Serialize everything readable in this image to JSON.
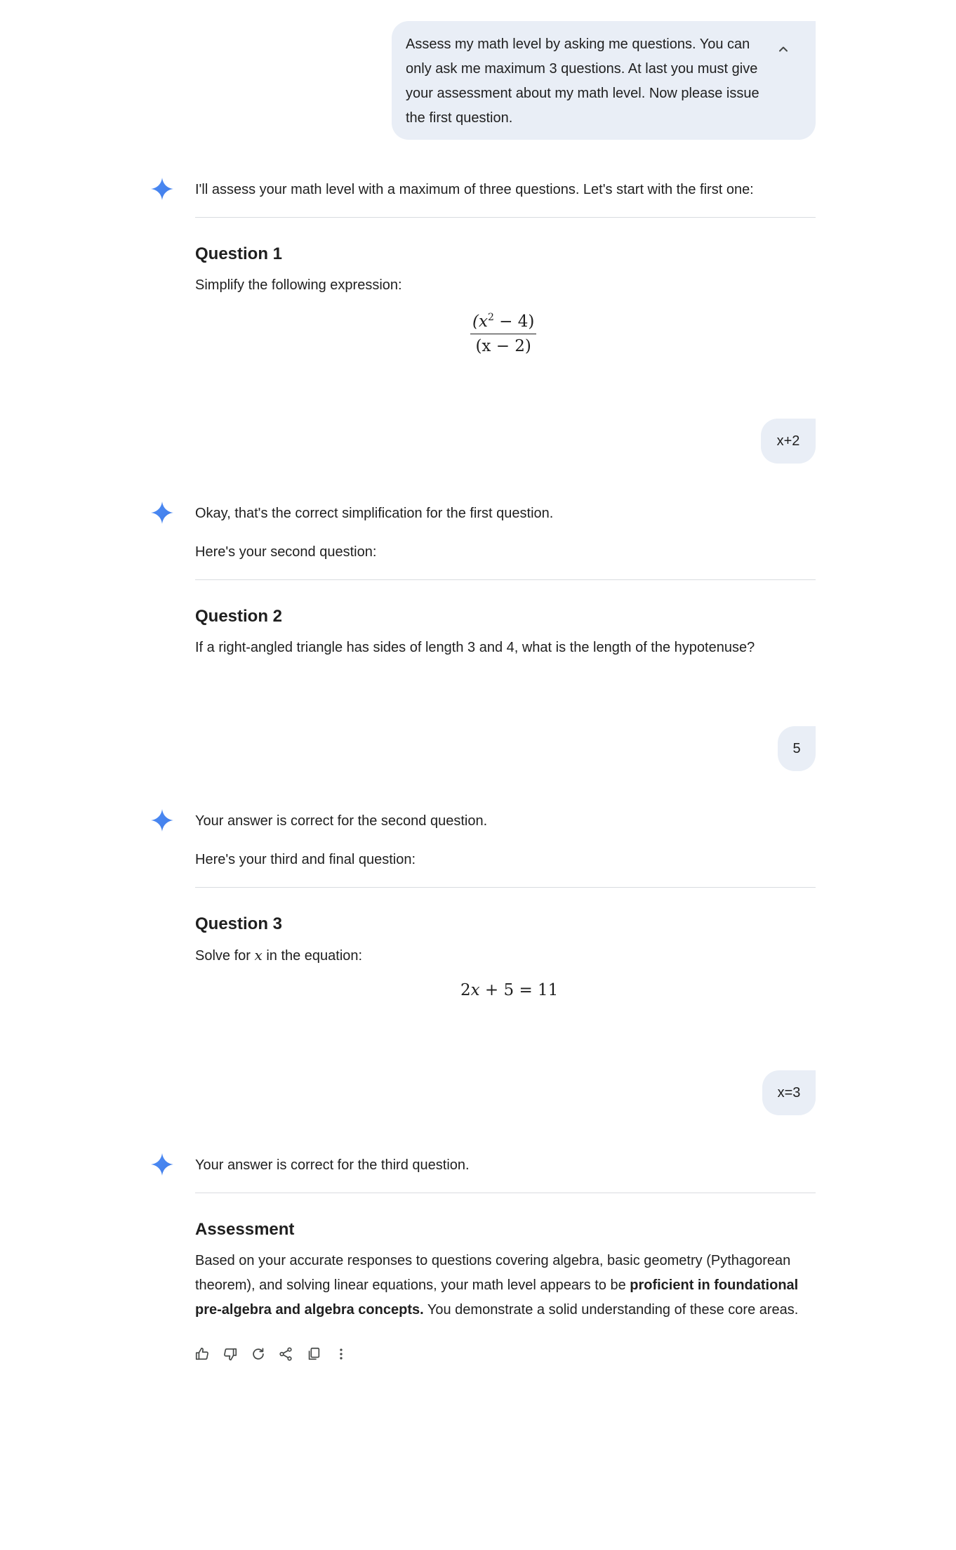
{
  "conversation": {
    "user_1": {
      "text": "Assess my math level by asking me questions. You can only ask me maximum 3 questions. At last you must give your assessment about my math level. Now please issue the first question."
    },
    "assistant_1": {
      "intro": "I'll assess your math level with a maximum of three questions. Let's start with the first one:",
      "heading": "Question 1",
      "prompt": "Simplify the following expression:",
      "numerator_base": "(x",
      "numerator_exp": "2",
      "numerator_rest": " − 4)",
      "denominator": "(x − 2)"
    },
    "user_2": {
      "text": "x+2"
    },
    "assistant_2": {
      "line1": "Okay, that's the correct simplification for the first question.",
      "line2": "Here's your second question:",
      "heading": "Question 2",
      "prompt": "If a right-angled triangle has sides of length 3 and 4, what is the length of the hypotenuse?"
    },
    "user_3": {
      "text": "5"
    },
    "assistant_3": {
      "line1": "Your answer is correct for the second question.",
      "line2": "Here's your third and final question:",
      "heading": "Question 3",
      "prompt_before": "Solve for ",
      "prompt_var": "x",
      "prompt_after": " in the equation:",
      "equation": {
        "coef": "2",
        "var": "x",
        "rest": " + 5 = 11"
      }
    },
    "user_4": {
      "text": "x=3"
    },
    "assistant_4": {
      "line1": "Your answer is correct for the third question.",
      "heading": "Assessment",
      "para_start": "Based on your accurate responses to questions covering algebra, basic geometry (Pythagorean theorem), and solving linear equations, your math level appears to be ",
      "para_bold": "proficient in foundational pre-algebra and algebra concepts.",
      "para_end": " You demonstrate a solid understanding of these core areas."
    }
  },
  "actions": {
    "icons": [
      "thumbs-up-icon",
      "thumbs-down-icon",
      "regenerate-icon",
      "share-icon",
      "copy-icon",
      "more-vert-icon"
    ]
  },
  "colors": {
    "user_bubble": "#e9eef6",
    "spark_blue": "#4285f4",
    "divider": "#d9dce0",
    "text": "#1f1f1f",
    "icon": "#444746"
  }
}
